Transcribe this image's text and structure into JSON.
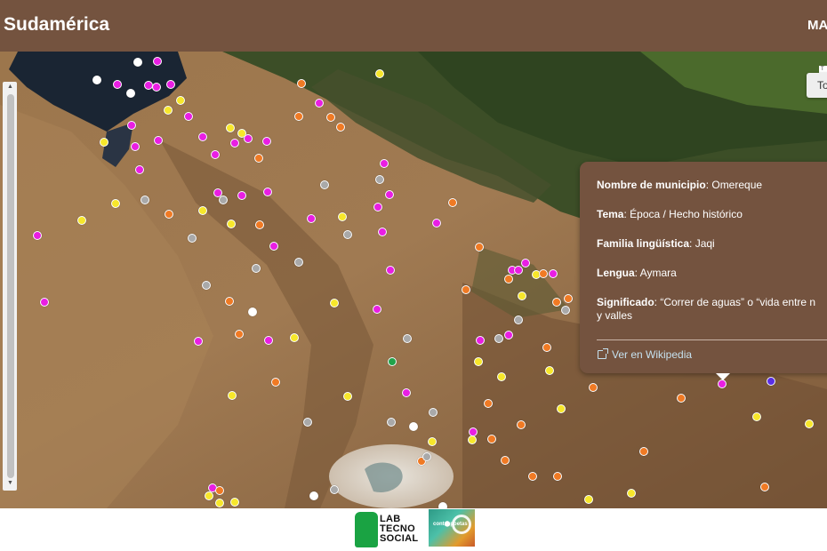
{
  "header": {
    "title": "Sudamérica",
    "nav_label": "MA"
  },
  "map": {
    "button_label": "To",
    "button_tooltip": "T",
    "marker_colors": {
      "magenta": "#e91ee3",
      "orange": "#f07a24",
      "yellow": "#f7e72b",
      "white": "#ffffff",
      "gray": "#a9a9a9",
      "green": "#21a34b",
      "purple": "#5a2ee6"
    }
  },
  "popup": {
    "municipio_label": "Nombre de municipio",
    "municipio_value": ": Omereque",
    "tema_label": "Tema",
    "tema_value": ": Época / Hecho histórico",
    "familia_label": "Familia lingüística",
    "familia_value": ": Jaqi",
    "lengua_label": "Lengua",
    "lengua_value": ": Aymara",
    "significado_label": "Significado",
    "significado_value": ": “Correr de aguas” o “vida entre n",
    "significado_value_2": "y valles",
    "link_label": "Ver en Wikipedia",
    "background": "#74533f"
  },
  "footer": {
    "logo_lab_line1": "LAB",
    "logo_lab_line2": "TECNO",
    "logo_lab_line3": "SOCIAL",
    "logo_cont_text": "cont⬤poetas"
  }
}
